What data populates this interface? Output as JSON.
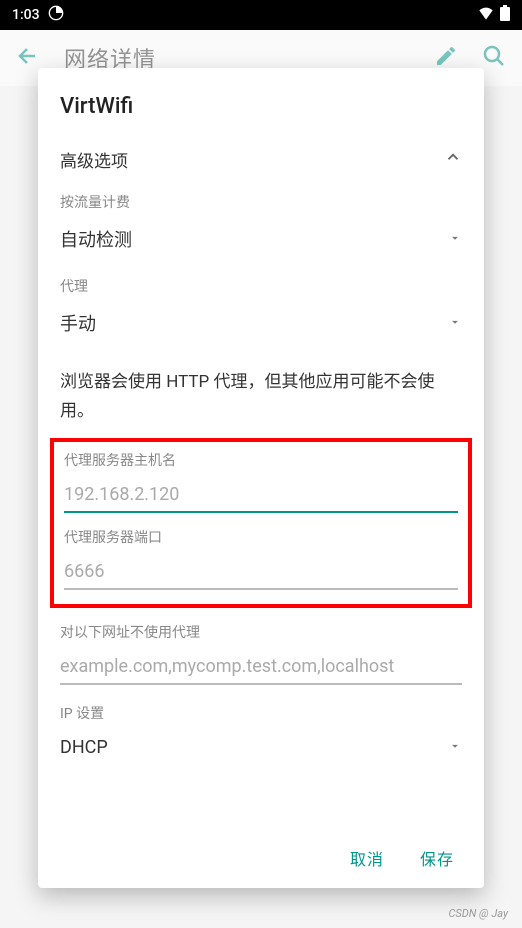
{
  "status": {
    "time": "1:03"
  },
  "appbar": {
    "title": "网络详情"
  },
  "dialog": {
    "title": "VirtWifi",
    "advanced_label": "高级选项",
    "metered": {
      "label": "按流量计费",
      "value": "自动检测"
    },
    "proxy": {
      "label": "代理",
      "value": "手动"
    },
    "proxy_info": "浏览器会使用 HTTP 代理，但其他应用可能不会使用。",
    "hostname": {
      "label": "代理服务器主机名",
      "value": "192.168.2.120"
    },
    "port": {
      "label": "代理服务器端口",
      "value": "6666"
    },
    "bypass": {
      "label": "对以下网址不使用代理",
      "placeholder": "example.com,mycomp.test.com,localhost"
    },
    "ip_settings": {
      "label": "IP 设置",
      "value": "DHCP"
    },
    "actions": {
      "cancel": "取消",
      "save": "保存"
    }
  },
  "watermark": "CSDN @ Jay"
}
